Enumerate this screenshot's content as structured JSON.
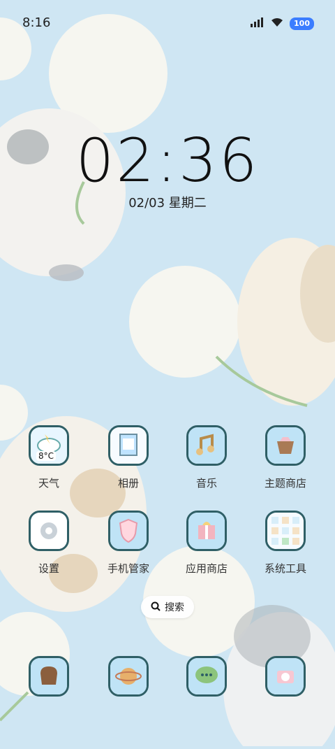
{
  "status_bar": {
    "time": "8:16",
    "battery": "100",
    "icons": [
      "signal-icon",
      "wifi-icon",
      "battery-icon"
    ]
  },
  "lockscreen": {
    "clock": "02:36",
    "date": "02/03 星期二"
  },
  "apps": [
    {
      "label": "天气",
      "icon": "weather-icon",
      "badge": "8°C"
    },
    {
      "label": "相册",
      "icon": "album-icon"
    },
    {
      "label": "音乐",
      "icon": "music-icon"
    },
    {
      "label": "主题商店",
      "icon": "theme-store-icon"
    },
    {
      "label": "设置",
      "icon": "settings-icon"
    },
    {
      "label": "手机管家",
      "icon": "security-icon"
    },
    {
      "label": "应用商店",
      "icon": "app-store-icon"
    },
    {
      "label": "系统工具",
      "icon": "system-tools-folder-icon"
    }
  ],
  "search": {
    "label": "搜索"
  },
  "dock": [
    {
      "icon": "bread-icon"
    },
    {
      "icon": "planet-icon"
    },
    {
      "icon": "message-icon"
    },
    {
      "icon": "camera-icon"
    }
  ],
  "colors": {
    "background": "#cfe6f3",
    "icon_border": "#2f5f66",
    "battery": "#3b7dff"
  }
}
